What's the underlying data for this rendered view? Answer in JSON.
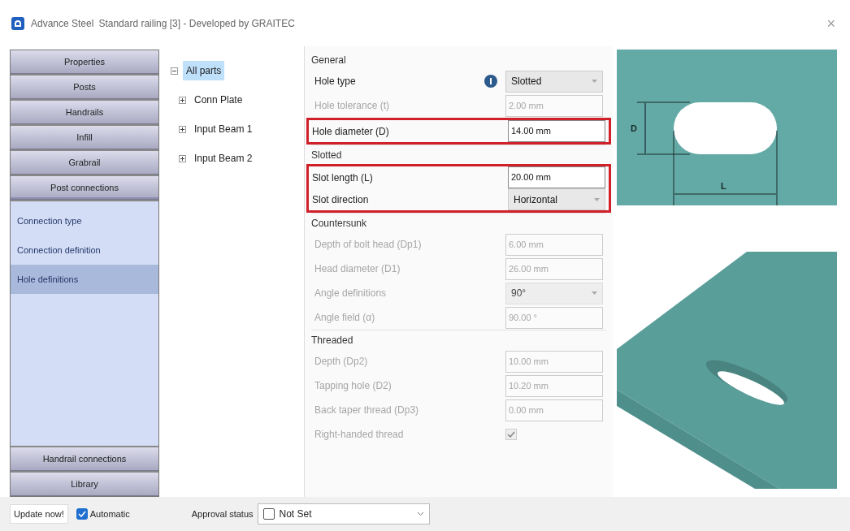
{
  "window": {
    "app": "Advance Steel",
    "title": "Standard railing [3] - Developed by GRAITEC",
    "close": "×"
  },
  "nav": {
    "sections": [
      {
        "label": "Properties",
        "expanded": false
      },
      {
        "label": "Posts",
        "expanded": false
      },
      {
        "label": "Handrails",
        "expanded": false
      },
      {
        "label": "Infill",
        "expanded": false
      },
      {
        "label": "Grabrail",
        "expanded": false
      },
      {
        "label": "Post connections",
        "expanded": true,
        "items": [
          {
            "label": "Connection type",
            "selected": false
          },
          {
            "label": "Connection definition",
            "selected": false
          },
          {
            "label": "Hole definitions",
            "selected": true
          }
        ]
      },
      {
        "label": "Handrail connections",
        "expanded": false
      },
      {
        "label": "Library",
        "expanded": false
      }
    ]
  },
  "tree": {
    "label": "All parts",
    "expanded": true,
    "selected": true,
    "children": [
      {
        "label": "Conn Plate",
        "expanded": false,
        "selected": false
      },
      {
        "label": "Input Beam 1",
        "expanded": false,
        "selected": false
      },
      {
        "label": "Input Beam 2",
        "expanded": false,
        "selected": false
      }
    ]
  },
  "form": {
    "sections": [
      {
        "title": "General",
        "rows": [
          {
            "kind": "select",
            "label": "Hole type",
            "value": "Slotted",
            "disabled": false,
            "info": true
          },
          {
            "kind": "text",
            "label": "Hole tolerance (t)",
            "value": "2.00 mm",
            "disabled": true
          },
          {
            "kind": "text",
            "label": "Hole diameter (D)",
            "value": "14.00 mm",
            "disabled": false,
            "highlighted": true
          }
        ]
      },
      {
        "title": "Slotted",
        "rows": [
          {
            "kind": "text",
            "label": "Slot length (L)",
            "value": "20.00 mm",
            "disabled": false,
            "highlighted": true
          },
          {
            "kind": "select",
            "label": "Slot direction",
            "value": "Horizontal",
            "disabled": false,
            "highlighted": true
          }
        ]
      },
      {
        "title": "Countersunk",
        "rows": [
          {
            "kind": "text",
            "label": "Depth of bolt head (Dp1)",
            "value": "6.00 mm",
            "disabled": true
          },
          {
            "kind": "text",
            "label": "Head diameter (D1)",
            "value": "26.00 mm",
            "disabled": true
          },
          {
            "kind": "select",
            "label": "Angle definitions",
            "value": "90°",
            "disabled": true
          },
          {
            "kind": "text",
            "label": "Angle field (α)",
            "value": "90.00 °",
            "disabled": true
          }
        ]
      },
      {
        "title": "Threaded",
        "rows": [
          {
            "kind": "text",
            "label": "Depth (Dp2)",
            "value": "10.00 mm",
            "disabled": true
          },
          {
            "kind": "text",
            "label": "Tapping hole (D2)",
            "value": "10.20 mm",
            "disabled": true
          },
          {
            "kind": "text",
            "label": "Back taper thread (Dp3)",
            "value": "0.00 mm",
            "disabled": true
          },
          {
            "kind": "checkbox",
            "label": "Right-handed thread",
            "checked": true,
            "disabled": true
          }
        ]
      }
    ]
  },
  "diagram": {
    "diameter_label": "D",
    "length_label": "L"
  },
  "footer": {
    "update_button": "Update now!",
    "automatic": {
      "label": "Automatic",
      "checked": true
    },
    "approval": {
      "label": "Approval status",
      "value": "Not Set",
      "checked": false
    }
  }
}
